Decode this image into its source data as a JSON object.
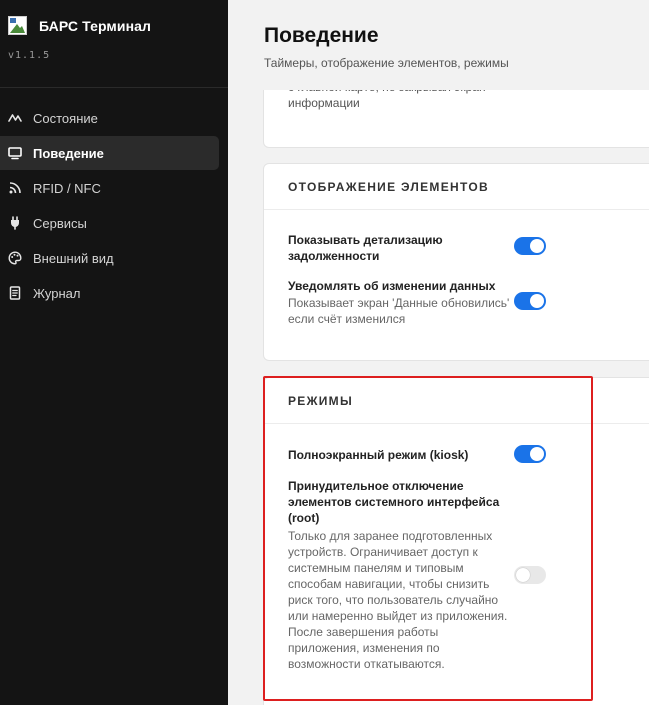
{
  "app": {
    "title": "БАРС Терминал",
    "version": "v1.1.5"
  },
  "sidebar": {
    "items": [
      {
        "label": "Состояние",
        "icon": "activity-icon",
        "active": false
      },
      {
        "label": "Поведение",
        "icon": "monitor-icon",
        "active": true
      },
      {
        "label": "RFID / NFC",
        "icon": "rss-icon",
        "active": false
      },
      {
        "label": "Сервисы",
        "icon": "plug-icon",
        "active": false
      },
      {
        "label": "Внешний вид",
        "icon": "palette-icon",
        "active": false
      },
      {
        "label": "Журнал",
        "icon": "journal-icon",
        "active": false
      }
    ]
  },
  "header": {
    "title": "Поведение",
    "subtitle": "Таймеры, отображение элементов, режимы"
  },
  "cards": {
    "top": {
      "clipped_text": "с главной карте, не закрывая экран информации"
    },
    "display": {
      "title": "ОТОБРАЖЕНИЕ ЭЛЕМЕНТОВ",
      "rows": [
        {
          "title": "Показывать детализацию задолженности",
          "desc": "",
          "enabled": true
        },
        {
          "title": "Уведомлять об изменении данных",
          "desc": "Показывает экран 'Данные обновились' если счёт изменился",
          "enabled": true
        }
      ]
    },
    "modes": {
      "title": "РЕЖИМЫ",
      "rows": [
        {
          "title": "Полноэкранный режим (kiosk)",
          "desc": "",
          "enabled": true
        },
        {
          "title": "Принудительное отключение элементов системного интерфейса (root)",
          "desc": "Только для заранее подготовленных устройств. Ограничивает доступ к системным панелям и типовым способам навигации, чтобы снизить риск того, что пользователь случайно или намеренно выйдет из приложения. После завершения работы приложения, изменения по возможности откатываются.",
          "enabled": false
        }
      ]
    }
  },
  "colors": {
    "accent": "#1a73e8",
    "sidebar_bg": "#141414",
    "highlight": "#dd1f1f"
  }
}
